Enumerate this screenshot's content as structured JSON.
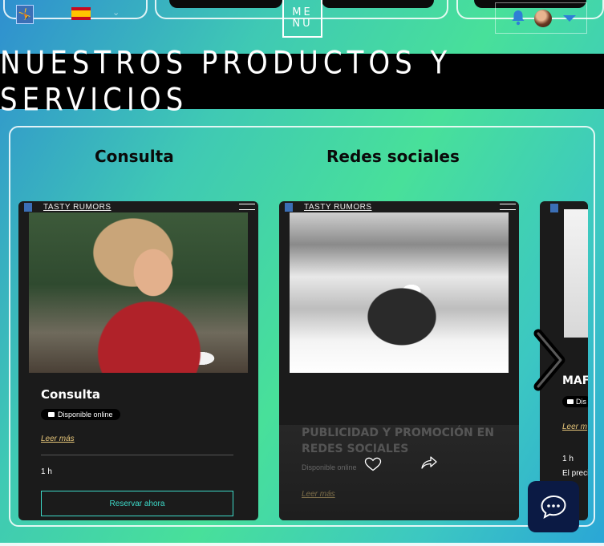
{
  "header": {
    "logo_glyph": "🤸",
    "language_flag": "spain-flag-icon",
    "menu_label_line1": "ME",
    "menu_label_line2": "NU",
    "notification_icon": "bell-icon",
    "user_avatar": "avatar",
    "user_menu_icon": "caret-down-icon"
  },
  "banner": {
    "title": "Nuestros productos y servicios"
  },
  "categories": [
    "Consulta",
    "Redes sociales"
  ],
  "cards": [
    {
      "mini_header": "TASTY RUMORS",
      "title": "Consulta",
      "badge": "Disponible online",
      "more": "Leer más",
      "duration": "1 h",
      "cta": "Reservar ahora"
    },
    {
      "mini_header": "TASTY RUMORS",
      "title": "PUBLICIDAD Y PROMOCIÓN EN REDES SOCIALES",
      "badge": "Disponible online",
      "more": "Leer más"
    },
    {
      "title": "MAF",
      "badge": "Dis",
      "more": "Leer m",
      "duration": "1 h",
      "price": "El preci"
    }
  ],
  "colors": {
    "banner_bg": "#000000",
    "accent": "#3dd9c8",
    "link": "#e8c77a",
    "chat_bg": "#0b1a44",
    "bell": "#2e7fd6"
  }
}
